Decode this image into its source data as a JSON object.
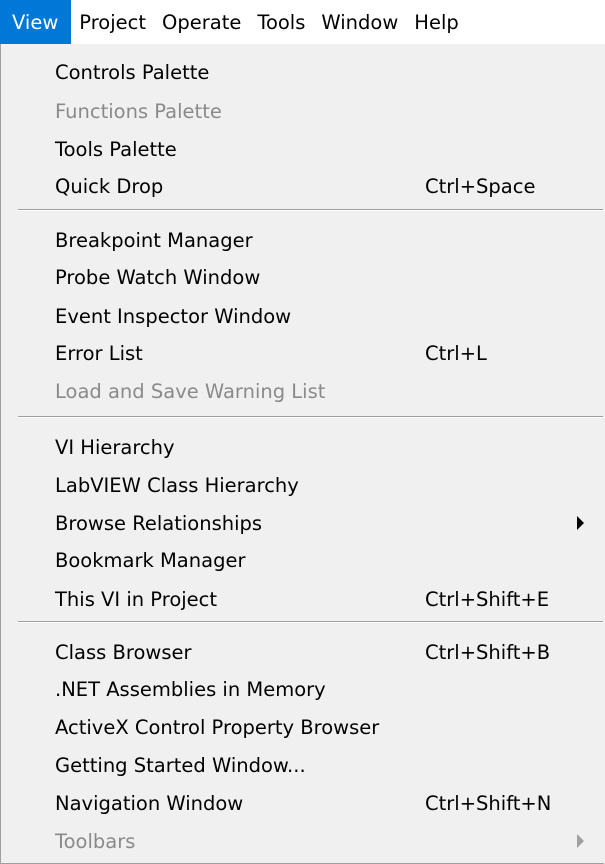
{
  "menubar": {
    "menus": [
      {
        "label": "View"
      },
      {
        "label": "Project"
      },
      {
        "label": "Operate"
      },
      {
        "label": "Tools"
      },
      {
        "label": "Window"
      },
      {
        "label": "Help"
      }
    ]
  },
  "dropdown": {
    "items": [
      {
        "label": "Controls Palette",
        "shortcut": "",
        "disabled": false,
        "submenu": false
      },
      {
        "label": "Functions Palette",
        "shortcut": "",
        "disabled": true,
        "submenu": false
      },
      {
        "label": "Tools Palette",
        "shortcut": "",
        "disabled": false,
        "submenu": false
      },
      {
        "label": "Quick Drop",
        "shortcut": "Ctrl+Space",
        "disabled": false,
        "submenu": false
      },
      {
        "label": "Breakpoint Manager",
        "shortcut": "",
        "disabled": false,
        "submenu": false
      },
      {
        "label": "Probe Watch Window",
        "shortcut": "",
        "disabled": false,
        "submenu": false
      },
      {
        "label": "Event Inspector Window",
        "shortcut": "",
        "disabled": false,
        "submenu": false
      },
      {
        "label": "Error List",
        "shortcut": "Ctrl+L",
        "disabled": false,
        "submenu": false
      },
      {
        "label": "Load and Save Warning List",
        "shortcut": "",
        "disabled": true,
        "submenu": false
      },
      {
        "label": "VI Hierarchy",
        "shortcut": "",
        "disabled": false,
        "submenu": false
      },
      {
        "label": "LabVIEW Class Hierarchy",
        "shortcut": "",
        "disabled": false,
        "submenu": false
      },
      {
        "label": "Browse Relationships",
        "shortcut": "",
        "disabled": false,
        "submenu": true
      },
      {
        "label": "Bookmark Manager",
        "shortcut": "",
        "disabled": false,
        "submenu": false
      },
      {
        "label": "This VI in Project",
        "shortcut": "Ctrl+Shift+E",
        "disabled": false,
        "submenu": false
      },
      {
        "label": "Class Browser",
        "shortcut": "Ctrl+Shift+B",
        "disabled": false,
        "submenu": false
      },
      {
        "label": ".NET Assemblies in Memory",
        "shortcut": "",
        "disabled": false,
        "submenu": false
      },
      {
        "label": "ActiveX Control Property Browser",
        "shortcut": "",
        "disabled": false,
        "submenu": false
      },
      {
        "label": "Getting Started Window...",
        "shortcut": "",
        "disabled": false,
        "submenu": false
      },
      {
        "label": "Navigation Window",
        "shortcut": "Ctrl+Shift+N",
        "disabled": false,
        "submenu": false
      },
      {
        "label": "Toolbars",
        "shortcut": "",
        "disabled": true,
        "submenu": true
      }
    ]
  }
}
